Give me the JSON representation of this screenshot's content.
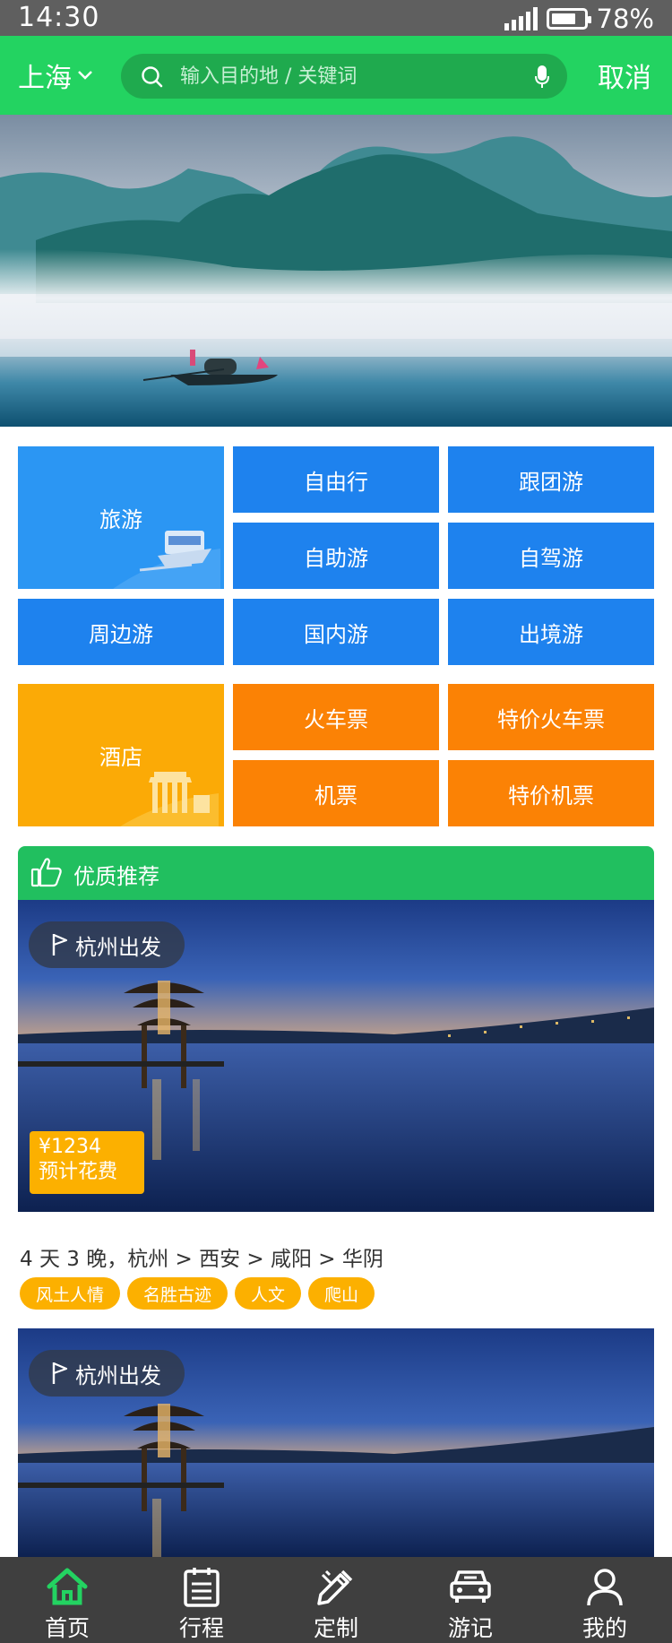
{
  "status": {
    "time": "14:30",
    "battery": "78%",
    "battery_level": 0.78
  },
  "header": {
    "city": "上海",
    "search_placeholder": "输入目的地 / 关键词",
    "cancel": "取消"
  },
  "categories": {
    "travel": {
      "main": "旅游",
      "items": [
        "自由行",
        "跟团游",
        "自助游",
        "自驾游",
        "周边游",
        "国内游",
        "出境游"
      ]
    },
    "hotel": {
      "main": "酒店",
      "items": [
        "火车票",
        "特价火车票",
        "机票",
        "特价机票"
      ]
    }
  },
  "recommend": {
    "title": "优质推荐"
  },
  "cards": [
    {
      "departure": "杭州出发",
      "price": "¥1234",
      "price_label": "预计花费",
      "route": "4 天 3 晚，杭州 > 西安 > 咸阳 > 华阴",
      "tags": [
        "风土人情",
        "名胜古迹",
        "人文",
        "爬山"
      ]
    },
    {
      "departure": "杭州出发"
    }
  ],
  "nav": [
    "首页",
    "行程",
    "定制",
    "游记",
    "我的"
  ],
  "colors": {
    "green": "#23d361",
    "blue": "#1e82ee",
    "orange": "#fb8205",
    "yellow": "#fcb000"
  }
}
